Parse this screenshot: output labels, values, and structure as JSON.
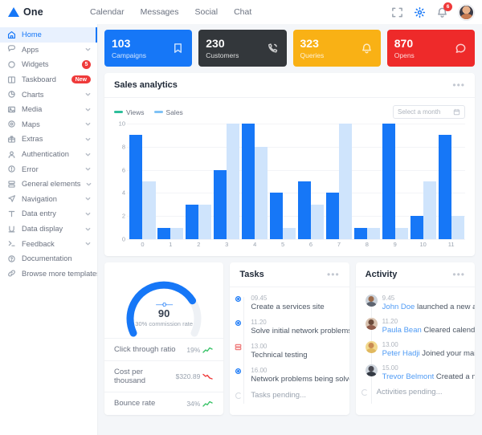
{
  "header": {
    "brand": "One",
    "nav": [
      "Calendar",
      "Messages",
      "Social",
      "Chat"
    ],
    "icons": {
      "fullscreen": "fullscreen-icon",
      "settings": "gear-icon",
      "bell": "bell-icon"
    },
    "notification_count": "6"
  },
  "sidebar": {
    "items": [
      {
        "label": "Home",
        "icon": "home-icon",
        "active": true,
        "chevron": false
      },
      {
        "label": "Apps",
        "icon": "apps-icon",
        "chevron": true
      },
      {
        "label": "Widgets",
        "icon": "widgets-icon",
        "badge": "5",
        "badge_shape": "circle"
      },
      {
        "label": "Taskboard",
        "icon": "taskboard-icon",
        "badge": "New",
        "badge_shape": "pill"
      },
      {
        "label": "Charts",
        "icon": "charts-icon",
        "chevron": true
      },
      {
        "label": "Media",
        "icon": "media-icon",
        "chevron": true
      },
      {
        "label": "Maps",
        "icon": "maps-icon",
        "chevron": true
      },
      {
        "label": "Extras",
        "icon": "extras-icon",
        "chevron": true
      },
      {
        "label": "Authentication",
        "icon": "user-icon",
        "chevron": true
      },
      {
        "label": "Error",
        "icon": "error-icon",
        "chevron": true
      },
      {
        "label": "General elements",
        "icon": "elements-icon",
        "chevron": true
      },
      {
        "label": "Navigation",
        "icon": "navigation-icon",
        "chevron": true
      },
      {
        "label": "Data entry",
        "icon": "text-icon",
        "chevron": true
      },
      {
        "label": "Data display",
        "icon": "display-icon",
        "chevron": true
      },
      {
        "label": "Feedback",
        "icon": "terminal-icon",
        "chevron": true
      },
      {
        "label": "Documentation",
        "icon": "documentation-icon",
        "chevron": false
      },
      {
        "label": "Browse more templates",
        "icon": "link-icon",
        "chevron": false
      }
    ]
  },
  "stats": [
    {
      "value": "103",
      "label": "Campaigns",
      "color": "#1677f7",
      "icon": "bookmark-icon"
    },
    {
      "value": "230",
      "label": "Customers",
      "color": "#33373b",
      "icon": "phone-icon"
    },
    {
      "value": "323",
      "label": "Queries",
      "color": "#f9b115",
      "icon": "bell-icon"
    },
    {
      "value": "870",
      "label": "Opens",
      "color": "#ee2a2a",
      "icon": "chat-icon"
    }
  ],
  "sales_card": {
    "title": "Sales analytics",
    "menu": "•••",
    "month_placeholder": "Select a month",
    "calendar_icon": "calendar-icon"
  },
  "chart_data": {
    "type": "bar",
    "title": "Sales analytics",
    "categories": [
      "0",
      "1",
      "2",
      "3",
      "4",
      "5",
      "6",
      "7",
      "8",
      "9",
      "10",
      "11"
    ],
    "series": [
      {
        "name": "Views",
        "color": "#1677f7",
        "values": [
          9,
          1,
          3,
          6,
          10,
          4,
          5,
          4,
          1,
          10,
          2,
          9
        ]
      },
      {
        "name": "Sales",
        "color": "#cfe4fc",
        "values": [
          5,
          1,
          3,
          10,
          8,
          1,
          3,
          10,
          1,
          1,
          5,
          2
        ]
      }
    ],
    "yticks": [
      "0",
      "2",
      "4",
      "6",
      "8",
      "10"
    ],
    "ylim": [
      0,
      10
    ],
    "xlabel": "",
    "ylabel": "",
    "grid": true,
    "legend_position": "top-left"
  },
  "gauge_card": {
    "value": "90",
    "subtitle": "30% commission rate",
    "percent": 75,
    "color": "#1677f7",
    "track": "#eef1f5",
    "rows": [
      {
        "label": "Click through ratio",
        "value": "19%",
        "trend": "up"
      },
      {
        "label": "Cost per thousand",
        "value": "$320.89",
        "trend": "down"
      },
      {
        "label": "Bounce rate",
        "value": "34%",
        "trend": "up"
      }
    ]
  },
  "tasks_card": {
    "title": "Tasks",
    "menu": "•••",
    "items": [
      {
        "time": "09.45",
        "text": "Create a services site",
        "marker": "circle"
      },
      {
        "time": "11.20",
        "text": "Solve initial network problems",
        "marker": "circle"
      },
      {
        "time": "13.00",
        "text": "Technical testing",
        "marker": "server"
      },
      {
        "time": "16.00",
        "text": "Network problems being solved",
        "marker": "circle"
      }
    ],
    "pending": "Tasks pending..."
  },
  "activity_card": {
    "title": "Activity",
    "menu": "•••",
    "items": [
      {
        "time": "9.45",
        "name": "John Doe",
        "text": " launched a new appli...",
        "avatar": "avatar-john"
      },
      {
        "time": "11.20",
        "name": "Paula Bean",
        "text": " Cleared calendar e...",
        "avatar": "avatar-paula"
      },
      {
        "time": "13.00",
        "name": "Peter Hadji",
        "text": " Joined your mailing...",
        "avatar": "avatar-peter"
      },
      {
        "time": "15.00",
        "name": "Trevor Belmont",
        "text": " Created a new ...",
        "avatar": "avatar-trevor"
      }
    ],
    "pending": "Activities pending..."
  }
}
